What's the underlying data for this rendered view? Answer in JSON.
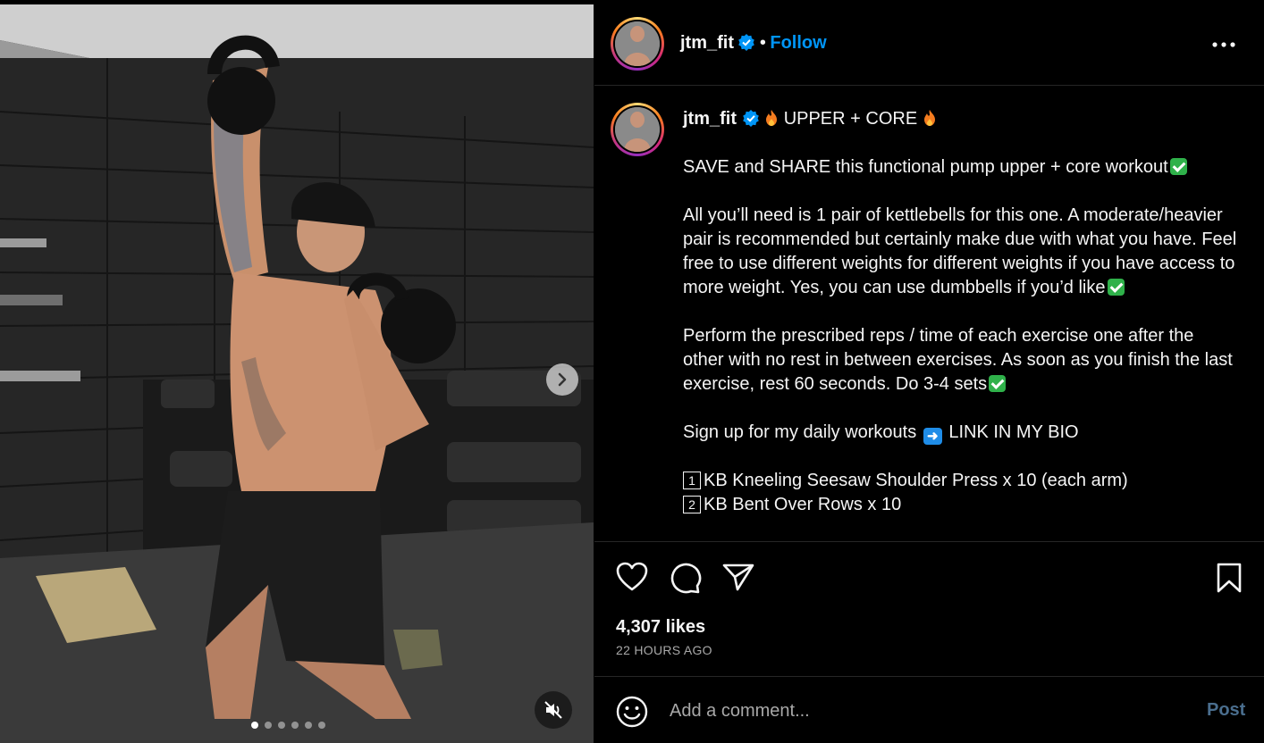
{
  "post": {
    "username": "jtm_fit",
    "verified": true,
    "follow_label": "Follow",
    "separator": "•",
    "more_icon": "more-options-icon"
  },
  "caption": {
    "username": "jtm_fit",
    "title": "UPPER + CORE",
    "line1": "SAVE and SHARE this functional pump upper + core workout",
    "para2": "All you’ll need is 1 pair of kettlebells for this one. A moderate/heavier pair is recommended but certainly make due with what you have. Feel free to use different weights for different weights if you have access to more weight. Yes, you can use dumbbells if you’d like",
    "para3": "Perform the prescribed reps / time of each exercise one after the other with no rest in between exercises. As soon as you finish the last exercise, rest 60 seconds. Do 3-4 sets",
    "signup_text": "Sign up for my daily workouts",
    "signup_link": "LINK IN MY BIO",
    "exercises": [
      {
        "num": "1",
        "text": "KB Kneeling Seesaw Shoulder Press x 10 (each arm)"
      },
      {
        "num": "2",
        "text": "KB Bent Over Rows x 10"
      }
    ]
  },
  "engagement": {
    "likes": "4,307 likes",
    "time": "22 HOURS AGO"
  },
  "comment": {
    "placeholder": "Add a comment...",
    "post_label": "Post"
  },
  "media": {
    "carousel_count": 6,
    "active_index": 0
  },
  "colors": {
    "accent": "#0095f6",
    "background": "#000000",
    "muted": "#a8a8a8",
    "check_green": "#2fb14a"
  }
}
